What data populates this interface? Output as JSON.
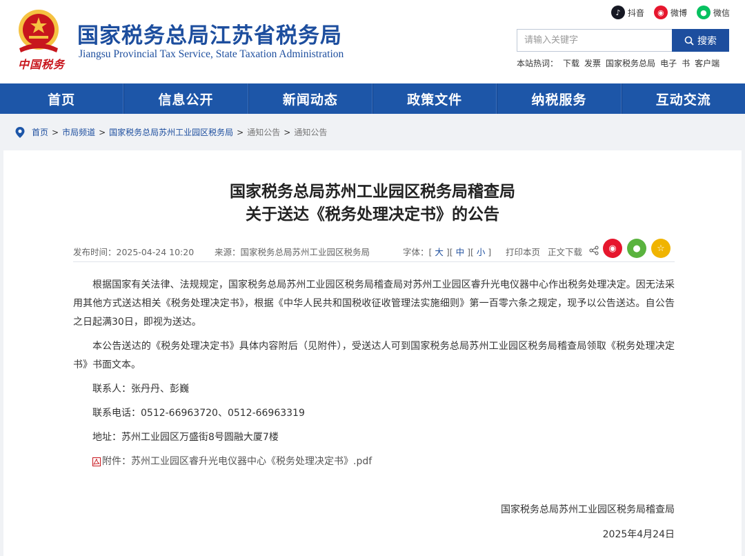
{
  "header": {
    "title": "国家税务总局江苏省税务局",
    "subtitle": "Jiangsu Provincial Tax Service, State Taxation Administration",
    "emblem_text": "中国税务",
    "social": [
      {
        "label": "抖音",
        "icon": "douyin-icon",
        "color": "#161823"
      },
      {
        "label": "微博",
        "icon": "weibo-icon",
        "color": "#e6162d"
      },
      {
        "label": "微信",
        "icon": "wechat-icon",
        "color": "#07c160"
      }
    ],
    "search": {
      "placeholder": "请输入关键字",
      "button_label": "搜索"
    },
    "hotwords": {
      "label": "本站热词：",
      "items": [
        "下载",
        "发票",
        "国家税务总局",
        "电子",
        "书",
        "客户端"
      ]
    }
  },
  "nav": {
    "items": [
      "首页",
      "信息公开",
      "新闻动态",
      "政策文件",
      "纳税服务",
      "互动交流"
    ]
  },
  "breadcrumb": {
    "items": [
      "首页",
      "市局频道",
      "国家税务总局苏州工业园区税务局",
      "通知公告",
      "通知公告"
    ],
    "sep": ">"
  },
  "article": {
    "title_line1": "国家税务总局苏州工业园区税务局稽查局",
    "title_line2": "关于送达《税务处理决定书》的公告",
    "meta": {
      "date": "发布时间：2025-04-24 10:20",
      "source": "来源：国家税务总局苏州工业园区税务局",
      "font_label": "字体：",
      "font_large": "大",
      "font_medium": "中",
      "font_small": "小",
      "print": "打印本页",
      "download": "正文下载"
    },
    "paragraphs": [
      "根据国家有关法律、法规规定，国家税务总局苏州工业园区税务局稽查局对苏州工业园区睿升光电仪器中心作出税务处理决定。因无法采用其他方式送达相关《税务处理决定书》，根据《中华人民共和国税收征收管理法实施细则》第一百零六条之规定，现予以公告送达。自公告之日起满30日，即视为送达。",
      "本公告送达的《税务处理决定书》具体内容附后（见附件），受送达人可到国家税务总局苏州工业园区税务局稽查局领取《税务处理决定书》书面文本。"
    ],
    "contact": "联系人：张丹丹、彭巍",
    "phone": "联系电话：0512-66963720、0512-66963319",
    "address": "地址：苏州工业园区万盛街8号圆融大厦7楼",
    "attachment_label": "附件：",
    "attachment_name": "苏州工业园区睿升光电仪器中心《税务处理决定书》.pdf",
    "signature": "国家税务总局苏州工业园区税务局稽查局",
    "sign_date": "2025年4月24日"
  },
  "colors": {
    "brand": "#1d4e9e",
    "nav": "#1d56a8",
    "weibo": "#e6162d",
    "wechat": "#5ab33e",
    "favorite": "#f0b400"
  }
}
